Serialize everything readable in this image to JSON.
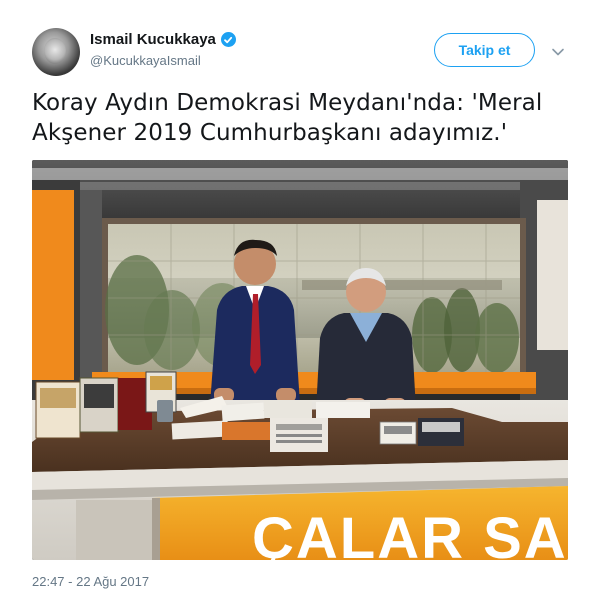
{
  "tweet": {
    "display_name": "Ismail Kucukkaya",
    "handle": "@KucukkayaIsmail",
    "verified": true,
    "follow_label": "Takip et",
    "text": "Koray Aydın Demokrasi Meydanı'nda: 'Meral Akşener 2019 Cumhurbaşkanı adayımız.'",
    "timestamp": "22:47 - 22 Ağu 2017"
  },
  "photo": {
    "banner_text": "ÇALAR SA",
    "book_cover_text": "MERAL AKŞENER",
    "newspaper_text": "AKŞENER"
  },
  "colors": {
    "accent": "#1da1f2",
    "secondary_text": "#657786",
    "studio_orange": "#f08a1c",
    "banner_yellow": "#f3a51c"
  },
  "icons": {
    "verified": "verified-badge-icon",
    "caret": "chevron-down-icon"
  }
}
